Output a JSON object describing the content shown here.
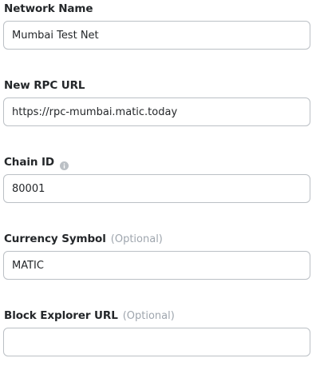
{
  "fields": [
    {
      "label": "Network Name",
      "value": "Mumbai Test Net",
      "placeholder": ""
    },
    {
      "label": "New RPC URL",
      "value": "https://rpc-mumbai.matic.today",
      "placeholder": ""
    },
    {
      "label": "Chain ID",
      "info_icon": "info-circle-icon",
      "value": "80001",
      "placeholder": ""
    },
    {
      "label": "Currency Symbol",
      "optional": "(Optional)",
      "value": "MATIC",
      "placeholder": ""
    },
    {
      "label": "Block Explorer URL",
      "optional": "(Optional)",
      "value": "",
      "placeholder": ""
    }
  ],
  "colors": {
    "label": "#24272a",
    "optional": "#9fa6ae",
    "input_border": "#bbc0c5",
    "info_icon": "#bbc0c5"
  }
}
